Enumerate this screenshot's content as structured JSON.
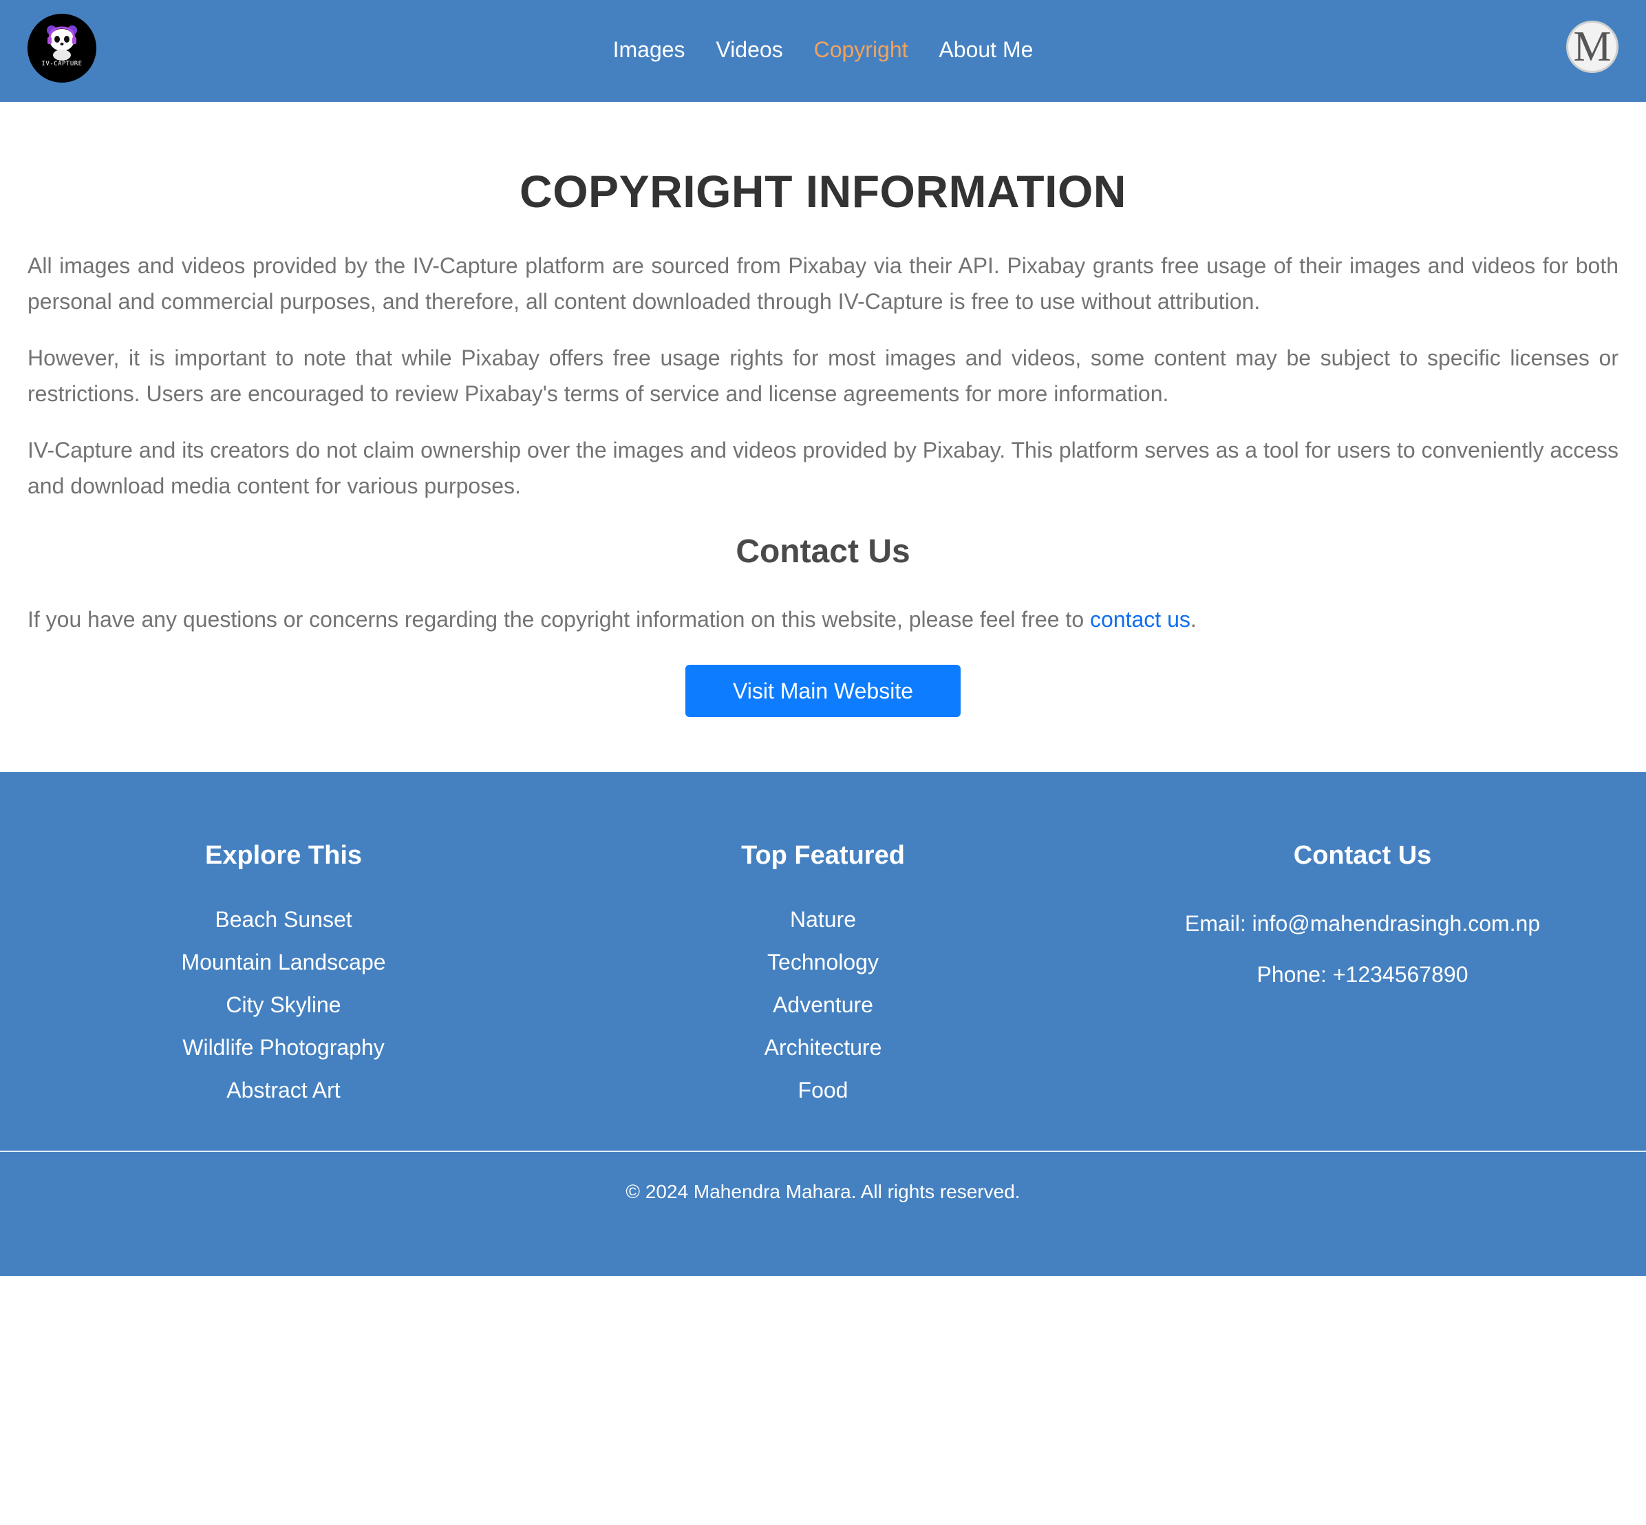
{
  "header": {
    "logo_text": "IV-CAPTURE",
    "nav": [
      {
        "label": "Images"
      },
      {
        "label": "Videos"
      },
      {
        "label": "Copyright",
        "active": true
      },
      {
        "label": "About Me"
      }
    ],
    "avatar_letter": "M"
  },
  "main": {
    "title": "COPYRIGHT INFORMATION",
    "paragraphs": [
      "All images and videos provided by the IV-Capture platform are sourced from Pixabay via their API. Pixabay grants free usage of their images and videos for both personal and commercial purposes, and therefore, all content downloaded through IV-Capture is free to use without attribution.",
      "However, it is important to note that while Pixabay offers free usage rights for most images and videos, some content may be subject to specific licenses or restrictions. Users are encouraged to review Pixabay's terms of service and license agreements for more information.",
      "IV-Capture and its creators do not claim ownership over the images and videos provided by Pixabay. This platform serves as a tool for users to conveniently access and download media content for various purposes."
    ],
    "contact_heading": "Contact Us",
    "contact_text_before": "If you have any questions or concerns regarding the copyright information on this website, please feel free to ",
    "contact_link": "contact us",
    "contact_text_after": ".",
    "visit_button": "Visit Main Website"
  },
  "footer": {
    "explore": {
      "heading": "Explore This",
      "items": [
        "Beach Sunset",
        "Mountain Landscape",
        "City Skyline",
        "Wildlife Photography",
        "Abstract Art"
      ]
    },
    "featured": {
      "heading": "Top Featured",
      "items": [
        "Nature",
        "Technology",
        "Adventure",
        "Architecture",
        "Food"
      ]
    },
    "contact": {
      "heading": "Contact Us",
      "email": "Email: info@mahendrasingh.com.np",
      "phone": "Phone: +1234567890"
    },
    "copyright": "© 2024 Mahendra Mahara. All rights reserved."
  },
  "colors": {
    "brand_blue": "#4581c1",
    "active_nav": "#f0a35e",
    "button_blue": "#0d7cff",
    "link_blue": "#0d6ef0"
  }
}
